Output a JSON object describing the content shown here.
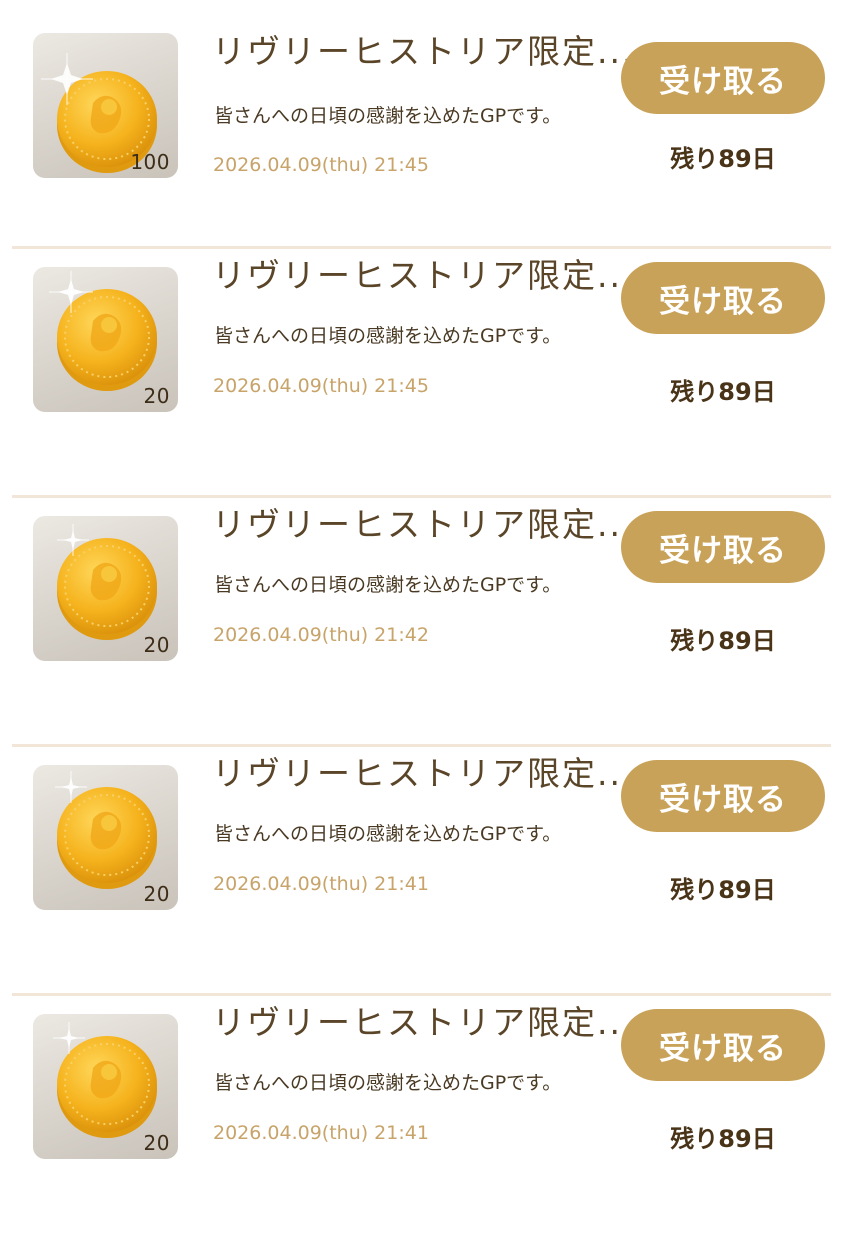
{
  "items": [
    {
      "title": "リヴリーヒストリア限定...",
      "description": "皆さんへの日頃の感謝を込めたGPです。",
      "date": "2026.04.09(thu) 21:45",
      "amount": "100",
      "button_label": "受け取る",
      "remaining": "残り89日",
      "icon": "gold-coin-icon"
    },
    {
      "title": "リヴリーヒストリア限定...",
      "description": "皆さんへの日頃の感謝を込めたGPです。",
      "date": "2026.04.09(thu) 21:45",
      "amount": "20",
      "button_label": "受け取る",
      "remaining": "残り89日",
      "icon": "gold-coin-icon"
    },
    {
      "title": "リヴリーヒストリア限定...",
      "description": "皆さんへの日頃の感謝を込めたGPです。",
      "date": "2026.04.09(thu) 21:42",
      "amount": "20",
      "button_label": "受け取る",
      "remaining": "残り89日",
      "icon": "gold-coin-icon"
    },
    {
      "title": "リヴリーヒストリア限定...",
      "description": "皆さんへの日頃の感謝を込めたGPです。",
      "date": "2026.04.09(thu) 21:41",
      "amount": "20",
      "button_label": "受け取る",
      "remaining": "残り89日",
      "icon": "gold-coin-icon"
    },
    {
      "title": "リヴリーヒストリア限定...",
      "description": "皆さんへの日頃の感謝を込めたGPです。",
      "date": "2026.04.09(thu) 21:41",
      "amount": "20",
      "button_label": "受け取る",
      "remaining": "残り89日",
      "icon": "gold-coin-icon"
    }
  ],
  "colors": {
    "button": "#c9a259",
    "date_text": "#c8a46a",
    "divider": "#f2e6d8",
    "coin_gold": "#f5b21c"
  }
}
